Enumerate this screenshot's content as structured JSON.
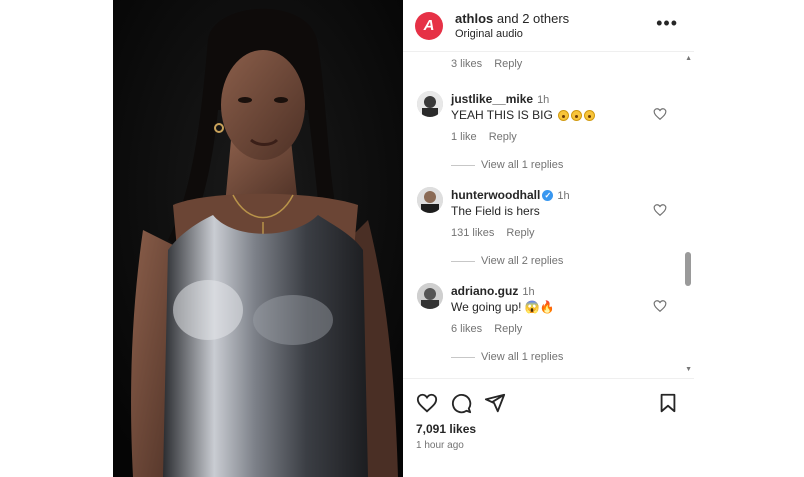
{
  "post": {
    "header": {
      "brand_letter": "A",
      "user": "athlos",
      "others": " and 2 others",
      "subtitle": "Original audio",
      "more": "•••"
    },
    "top_meta": {
      "likes": "3 likes",
      "reply": "Reply"
    },
    "comments": [
      {
        "user": "justlike__mike",
        "time": "1h",
        "text": "YEAH THIS IS BIG",
        "emoji_count": 3,
        "likes": "1 like",
        "reply": "Reply",
        "view_replies": "View all 1 replies"
      },
      {
        "user": "hunterwoodhall",
        "verified": true,
        "time": "1h",
        "text": "The Field is hers",
        "likes": "131 likes",
        "reply": "Reply",
        "view_replies": "View all 2 replies"
      },
      {
        "user": "adriano.guz",
        "time": "1h",
        "text": "We going up!",
        "emoji": "😱🔥",
        "likes": "6 likes",
        "reply": "Reply",
        "view_replies": "View all 1 replies"
      }
    ],
    "footer": {
      "likes": "7,091 likes",
      "time_ago": "1 hour ago",
      "icons": [
        "heart-icon",
        "comment-icon",
        "share-icon",
        "bookmark-icon"
      ]
    }
  },
  "colors": {
    "brand": "#e63146",
    "verified": "#3897f0",
    "muted": "#737373"
  }
}
